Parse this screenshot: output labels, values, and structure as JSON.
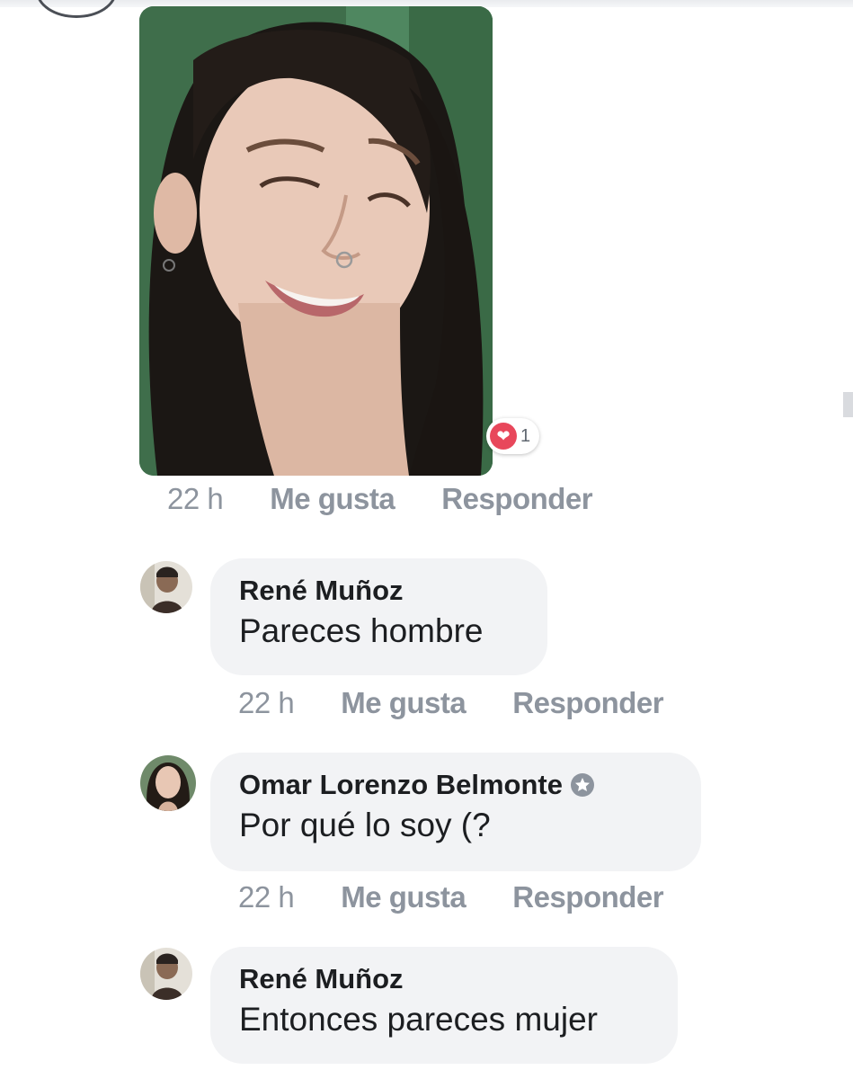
{
  "post_comment": {
    "time": "22 h",
    "like_label": "Me gusta",
    "reply_label": "Responder",
    "reaction": {
      "icon": "heart-icon",
      "count": "1",
      "color": "#e8475b"
    }
  },
  "replies": [
    {
      "author": "René Muñoz",
      "text": "Pareces hombre",
      "time": "22 h",
      "like_label": "Me gusta",
      "reply_label": "Responder"
    },
    {
      "author": "Omar Lorenzo Belmonte",
      "verified_icon": "shield-badge-icon",
      "text": "Por qué lo soy (?",
      "time": "22 h",
      "like_label": "Me gusta",
      "reply_label": "Responder"
    },
    {
      "author": "René Muñoz",
      "text": "Entonces pareces mujer"
    }
  ],
  "colors": {
    "bubble": "#f2f3f5",
    "meta_text": "#8d949e",
    "name_text": "#1c1e21"
  }
}
